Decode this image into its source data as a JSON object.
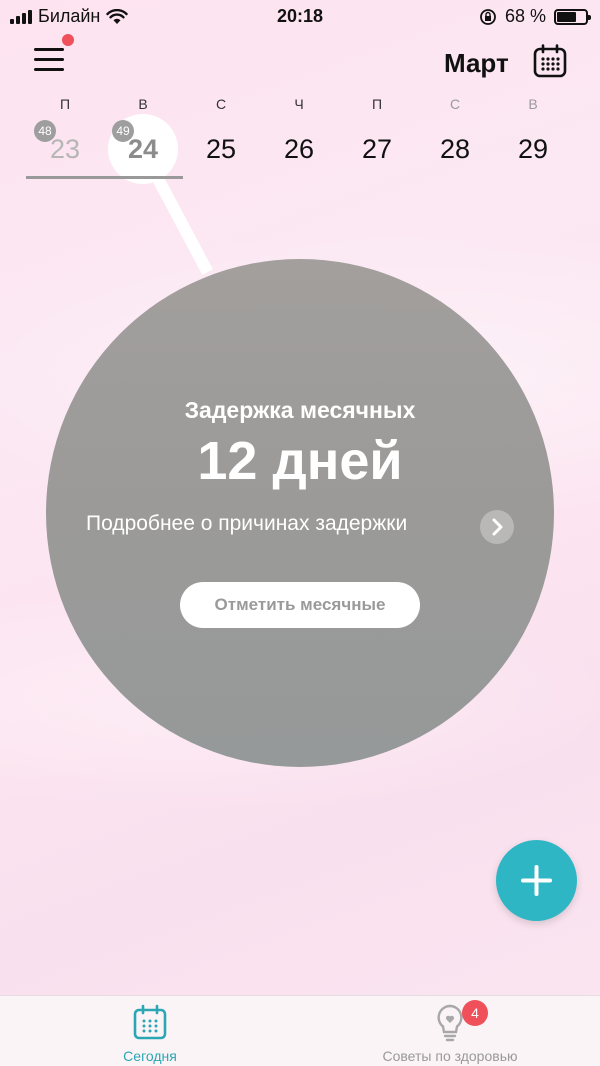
{
  "status_bar": {
    "carrier": "Билайн",
    "time": "20:18",
    "battery_percent": "68 %"
  },
  "header": {
    "month": "Март"
  },
  "week": {
    "days": [
      {
        "dow": "П",
        "num": "23",
        "badge": "48"
      },
      {
        "dow": "В",
        "num": "24",
        "badge": "49"
      },
      {
        "dow": "С",
        "num": "25"
      },
      {
        "dow": "Ч",
        "num": "26"
      },
      {
        "dow": "П",
        "num": "27"
      },
      {
        "dow": "С",
        "num": "28"
      },
      {
        "dow": "В",
        "num": "29"
      }
    ]
  },
  "main": {
    "delay_label": "Задержка месячных",
    "delay_days": "12 дней",
    "reasons_link": "Подробнее о причинах задержки",
    "mark_button": "Отметить месячные"
  },
  "tabbar": {
    "today_label": "Сегодня",
    "tips_label": "Советы по здоровью",
    "tips_badge": "4"
  },
  "colors": {
    "accent": "#2eb6c4",
    "badge_red": "#f0505a",
    "circle_gray": "#9b9a99"
  },
  "icons": [
    "menu-icon",
    "calendar-icon",
    "chevron-right-icon",
    "plus-icon",
    "lightbulb-heart-icon",
    "wifi-icon",
    "signal-icon",
    "battery-icon",
    "orientation-lock-icon"
  ]
}
